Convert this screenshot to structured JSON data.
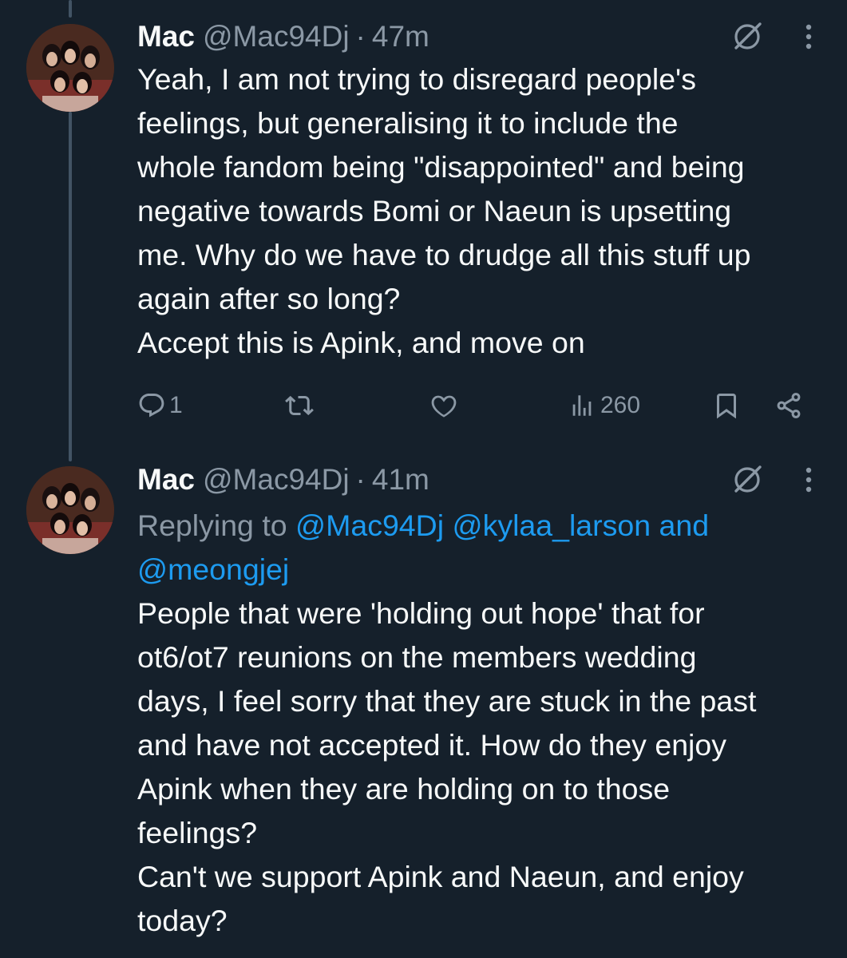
{
  "tweets": [
    {
      "name": "Mac",
      "handle": "@Mac94Dj",
      "separator": "·",
      "time": "47m",
      "text": "Yeah, I am not trying to disregard people's\nfeelings, but generalising it to include the\nwhole fandom being \"disappointed\" and being\nnegative towards Bomi or Naeun is upsetting\nme. Why do we have to drudge all this stuff up\nagain after so long?\nAccept this is Apink, and move on",
      "actions": {
        "reply_count": "1",
        "retweet_count": "",
        "like_count": "",
        "views": "260"
      }
    },
    {
      "name": "Mac",
      "handle": "@Mac94Dj",
      "separator": "·",
      "time": "41m",
      "replying_prefix": "Replying to ",
      "mention_1": "@Mac94Dj",
      "mention_2": "@kylaa_larson",
      "mention_and": "and",
      "mention_3": "@meongjej",
      "text": "People that were 'holding out hope' that for\not6/ot7 reunions on the members wedding\ndays, I feel sorry that they are stuck in the past\nand have not accepted it. How do they enjoy\nApink when they are holding on to those\nfeelings?\nCan't we support Apink and Naeun, and enjoy\ntoday?"
    }
  ],
  "icons": {
    "grok": "grok-icon",
    "more": "more-vertical-icon",
    "reply": "reply-icon",
    "retweet": "retweet-icon",
    "like": "heart-icon",
    "views": "views-icon",
    "bookmark": "bookmark-icon",
    "share": "share-icon"
  },
  "colors": {
    "background": "#15202b",
    "text": "#f7f9f9",
    "secondary": "#8b98a5",
    "link": "#1d9bf0",
    "thread_line": "#425364"
  }
}
